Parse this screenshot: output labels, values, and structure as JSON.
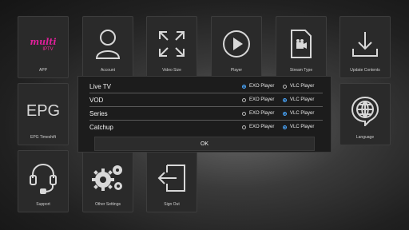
{
  "tiles": {
    "app": "APP",
    "account": "Account",
    "video_size": "Video Size",
    "player": "Player",
    "stream_type": "Stream Type",
    "update_contents": "Update Contents",
    "epg_timeshift": "EPG Timeshift",
    "language": "Language",
    "support": "Support",
    "other_settings": "Other Settings",
    "sign_out": "Sign Out",
    "epg_text": "EPG",
    "logo_text": "multi IPTV"
  },
  "dialog": {
    "rows": [
      {
        "name": "Live TV",
        "exo": "EXO Player",
        "vlc": "VLC Player",
        "selected": "exo"
      },
      {
        "name": "VOD",
        "exo": "EXO Player",
        "vlc": "VLC Player",
        "selected": "vlc"
      },
      {
        "name": "Series",
        "exo": "EXO Player",
        "vlc": "VLC Player",
        "selected": "vlc"
      },
      {
        "name": "Catchup",
        "exo": "EXO Player",
        "vlc": "VLC Player",
        "selected": "vlc"
      }
    ],
    "ok_label": "OK"
  },
  "colors": {
    "accent": "#4aa8ff",
    "tile_bg": "#2a2a2a",
    "dialog_bg": "#1c1c1c"
  }
}
